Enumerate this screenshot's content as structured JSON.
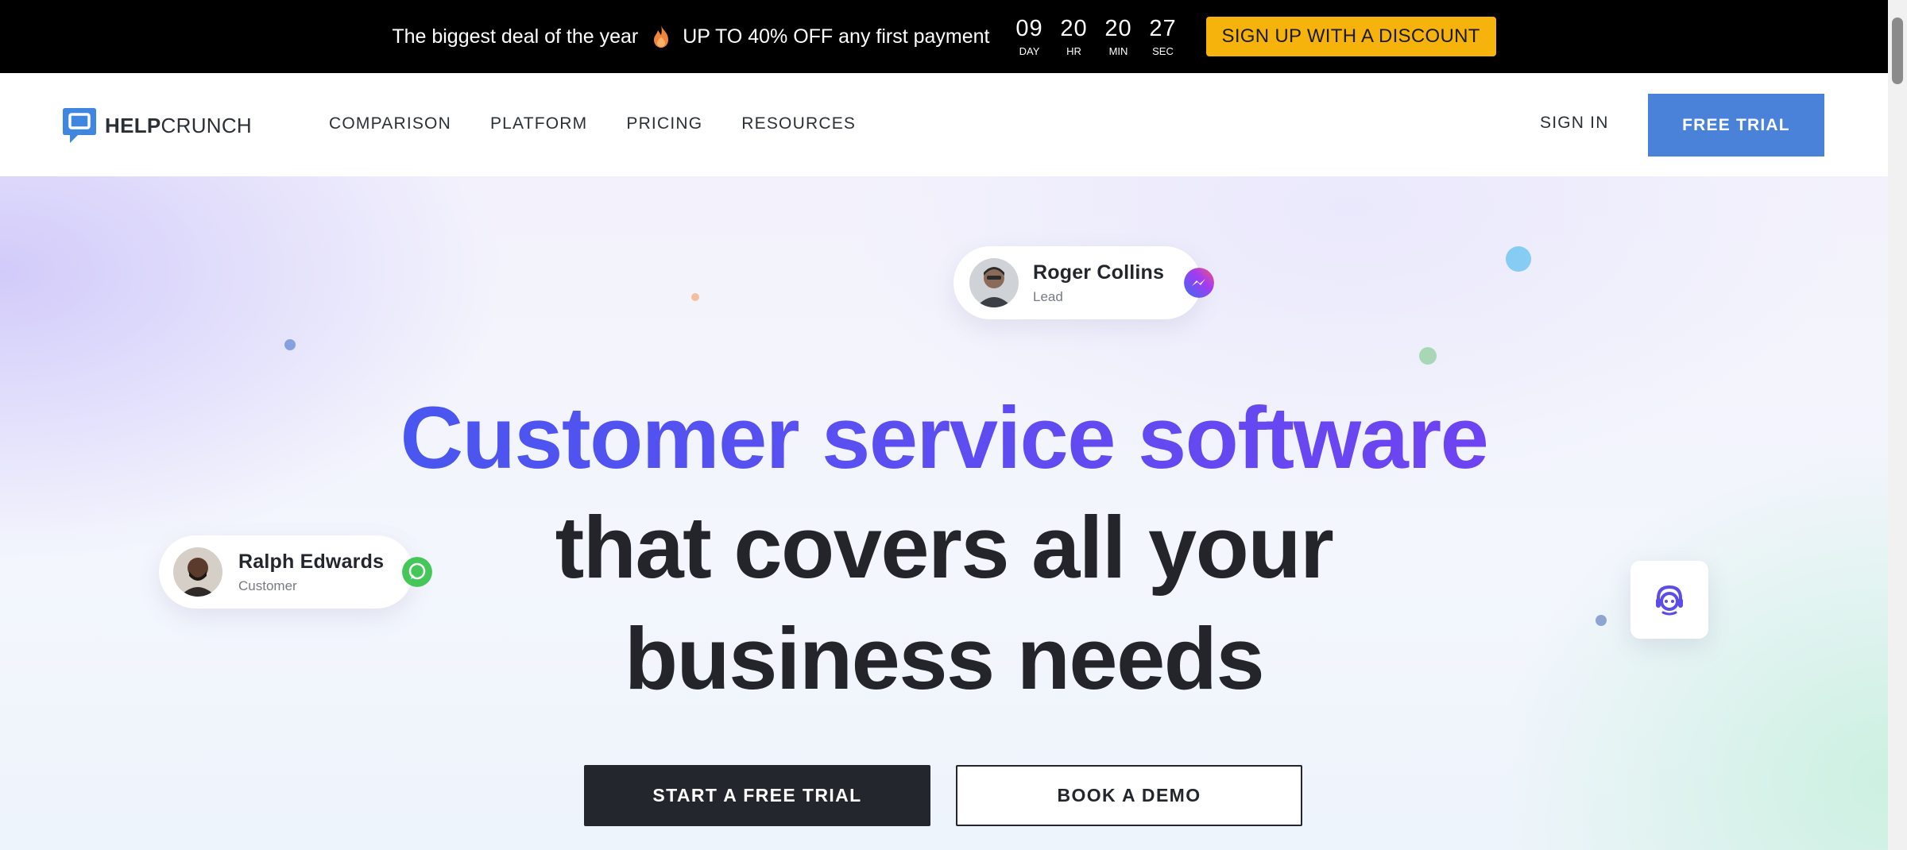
{
  "promo": {
    "text_before": "The biggest deal of the year",
    "text_after": "UP TO 40% OFF any first payment",
    "icon": "flame-icon",
    "countdown": [
      {
        "value": "09",
        "label": "DAY"
      },
      {
        "value": "20",
        "label": "HR"
      },
      {
        "value": "20",
        "label": "MIN"
      },
      {
        "value": "27",
        "label": "SEC"
      }
    ],
    "button_label": "SIGN UP WITH A DISCOUNT",
    "button_color": "#f6b30c"
  },
  "header": {
    "logo": {
      "bold": "HELP",
      "regular": "CRUNCH",
      "icon": "chat-bubble-logo-icon"
    },
    "nav": [
      {
        "label": "COMPARISON"
      },
      {
        "label": "PLATFORM"
      },
      {
        "label": "PRICING"
      },
      {
        "label": "RESOURCES"
      }
    ],
    "signin_label": "SIGN IN",
    "trial_label": "FREE TRIAL",
    "accent_color": "#4a82d9"
  },
  "hero": {
    "headline_line1": "Customer service software",
    "headline_line2": "that covers all your",
    "headline_line3": "business needs",
    "cards": [
      {
        "name": "Roger Collins",
        "role": "Lead",
        "channel_icon": "messenger-icon"
      },
      {
        "name": "Ralph Edwards",
        "role": "Customer",
        "channel_icon": "whatsapp-icon"
      }
    ],
    "primary_cta": "START A FREE TRIAL",
    "secondary_cta": "BOOK A DEMO",
    "support_widget_icon": "headset-agent-icon"
  }
}
